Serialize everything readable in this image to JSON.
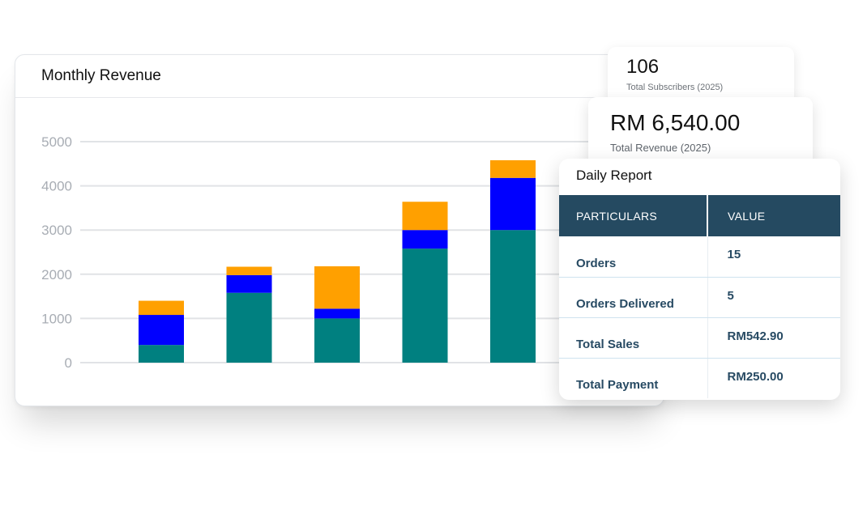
{
  "chart_card": {
    "title": "Monthly Revenue"
  },
  "subscribers": {
    "value": "106",
    "label": "Total Subscribers (2025)"
  },
  "revenue": {
    "value": "RM 6,540.00",
    "label": "Total Revenue (2025)"
  },
  "daily_report": {
    "title": "Daily Report",
    "headers": [
      "PARTICULARS",
      "VALUE"
    ],
    "rows": [
      {
        "particular": "Orders",
        "value": "15"
      },
      {
        "particular": "Orders Delivered",
        "value": "5"
      },
      {
        "particular": "Total Sales",
        "value": "RM542.90"
      },
      {
        "particular": "Total Payment",
        "value": "RM250.00"
      }
    ]
  },
  "chart_data": {
    "type": "bar",
    "stacked": true,
    "title": "Monthly Revenue",
    "xlabel": "",
    "ylabel": "",
    "ylim": [
      0,
      5000
    ],
    "yticks": [
      0,
      1000,
      2000,
      3000,
      4000,
      5000
    ],
    "grid": true,
    "categories": [
      "",
      "",
      "",
      "",
      "",
      ""
    ],
    "series": [
      {
        "color": "#008080",
        "values": [
          400,
          1580,
          1000,
          2580,
          3000,
          null
        ]
      },
      {
        "color": "#0000ff",
        "values": [
          680,
          400,
          220,
          420,
          1180,
          null
        ]
      },
      {
        "color": "#ffa000",
        "values": [
          320,
          190,
          960,
          640,
          400,
          null
        ]
      }
    ]
  }
}
